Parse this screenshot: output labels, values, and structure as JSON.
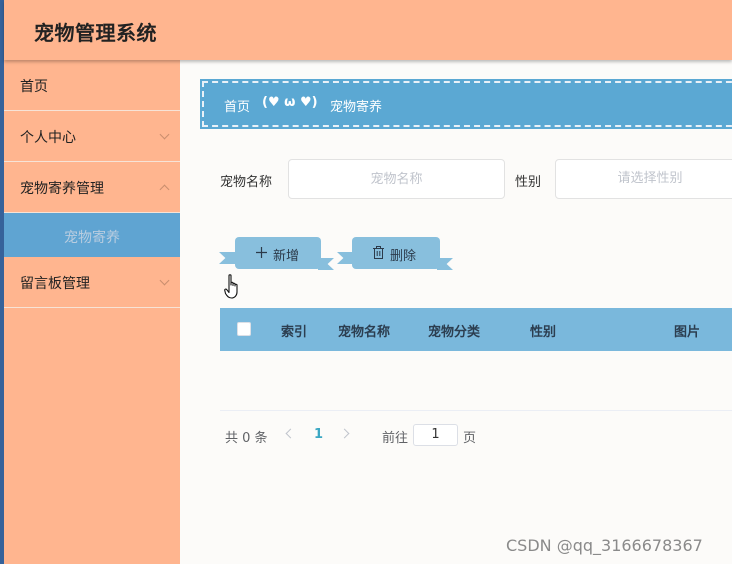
{
  "app": {
    "title": "宠物管理系统"
  },
  "sidebar": {
    "items": [
      {
        "label": "首页"
      },
      {
        "label": "个人中心"
      },
      {
        "label": "宠物寄养管理"
      },
      {
        "label": "宠物寄养"
      },
      {
        "label": "留言板管理"
      }
    ]
  },
  "breadcrumb": {
    "home": "首页",
    "separator": "(♥ ω ♥)",
    "current": "宠物寄养"
  },
  "search": {
    "name_label": "宠物名称",
    "name_placeholder": "宠物名称",
    "gender_label": "性别",
    "gender_placeholder": "请选择性别"
  },
  "actions": {
    "add_label": "新增",
    "delete_label": "删除"
  },
  "table": {
    "columns": [
      "索引",
      "宠物名称",
      "宠物分类",
      "性别",
      "图片"
    ],
    "rows": []
  },
  "pagination": {
    "total_text": "共 0 条",
    "current_page": "1",
    "goto_prefix": "前往",
    "goto_value": "1",
    "goto_suffix": "页"
  },
  "watermark": "CSDN @qq_3166678367",
  "colors": {
    "header": "#ffb58f",
    "sidebar": "#ffb58f",
    "accent": "#5ba8d3",
    "active_item": "#5fa4d2",
    "button": "#88bfdd",
    "table_header": "#7ab8dc"
  }
}
